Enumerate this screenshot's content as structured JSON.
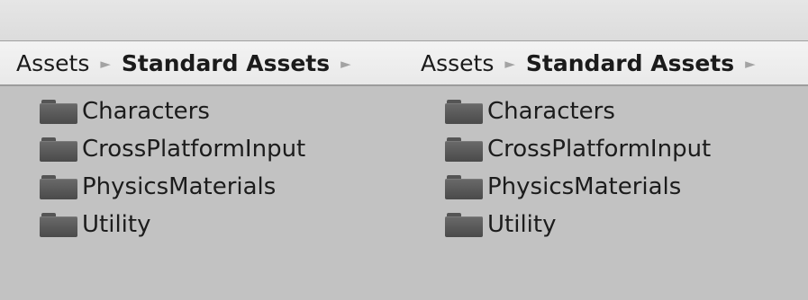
{
  "panes": [
    {
      "breadcrumb": {
        "parent": "Assets",
        "current": "Standard Assets",
        "separator": "►"
      },
      "items": [
        {
          "label": "Characters",
          "icon": "folder-icon"
        },
        {
          "label": "CrossPlatformInput",
          "icon": "folder-icon"
        },
        {
          "label": "PhysicsMaterials",
          "icon": "folder-icon"
        },
        {
          "label": "Utility",
          "icon": "folder-icon"
        }
      ]
    },
    {
      "breadcrumb": {
        "parent": "Assets",
        "current": "Standard Assets",
        "separator": "►"
      },
      "items": [
        {
          "label": "Characters",
          "icon": "folder-icon"
        },
        {
          "label": "CrossPlatformInput",
          "icon": "folder-icon"
        },
        {
          "label": "PhysicsMaterials",
          "icon": "folder-icon"
        },
        {
          "label": "Utility",
          "icon": "folder-icon"
        }
      ]
    }
  ],
  "colors": {
    "background": "#c2c2c2",
    "toolbar": "#e2e2e2",
    "breadcrumb_bar": "#efefef",
    "folder": "#555555",
    "text": "#1c1c1c",
    "separator": "#a3a3a3"
  }
}
